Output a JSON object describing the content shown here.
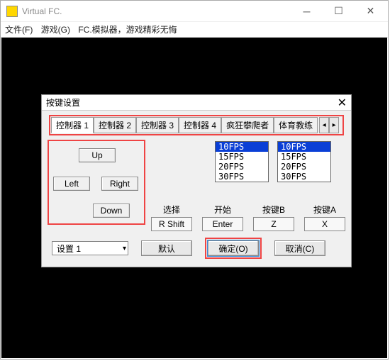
{
  "window": {
    "title": "Virtual FC.",
    "menu": [
      "文件(F)",
      "游戏(G)",
      "FC.模拟器，游戏精彩无悔"
    ]
  },
  "dialog": {
    "title": "按键设置",
    "tabs": [
      "控制器 1",
      "控制器 2",
      "控制器 3",
      "控制器 4",
      "疯狂攀爬者",
      "体育教练"
    ],
    "active_tab": 0,
    "dpad": {
      "up": "Up",
      "down": "Down",
      "left": "Left",
      "right": "Right"
    },
    "fps_lists": {
      "left": [
        "10FPS",
        "15FPS",
        "20FPS",
        "30FPS"
      ],
      "right": [
        "10FPS",
        "15FPS",
        "20FPS",
        "30FPS"
      ],
      "left_selected": 0,
      "right_selected": 0
    },
    "keycols": [
      {
        "label": "选择",
        "value": "R Shift"
      },
      {
        "label": "开始",
        "value": "Enter"
      },
      {
        "label": "按键B",
        "value": "Z"
      },
      {
        "label": "按键A",
        "value": "X"
      }
    ],
    "settings_combo": "设置 1",
    "buttons": {
      "default": "默认",
      "ok": "确定(O)",
      "cancel": "取消(C)"
    }
  }
}
